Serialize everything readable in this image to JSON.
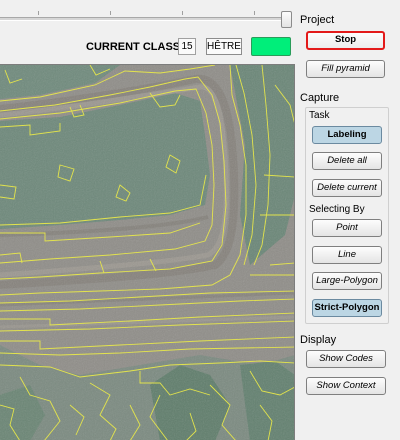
{
  "toolbar": {
    "current_class_label": "CURRENT CLASS:",
    "class_code": "15",
    "class_name": "HÊTRE",
    "class_color": "#00ee7a"
  },
  "panel": {
    "project": {
      "title": "Project",
      "stop_label": "Stop",
      "fill_pyramid_label": "Fill pyramid"
    },
    "capture": {
      "title": "Capture",
      "task": {
        "title": "Task",
        "labeling_label": "Labeling",
        "delete_all_label": "Delete all",
        "delete_current_label": "Delete current"
      },
      "selecting_by": {
        "title": "Selecting By",
        "point_label": "Point",
        "line_label": "Line",
        "large_polygon_label": "Large-Polygon",
        "strict_polygon_label": "Strict-Polygon"
      }
    },
    "display": {
      "title": "Display",
      "show_codes_label": "Show Codes",
      "show_context_label": "Show Context"
    }
  },
  "colors": {
    "segment_outline": "#e8e84a",
    "stop_border": "#e31a1a",
    "active_button": "#bcd6e4"
  }
}
